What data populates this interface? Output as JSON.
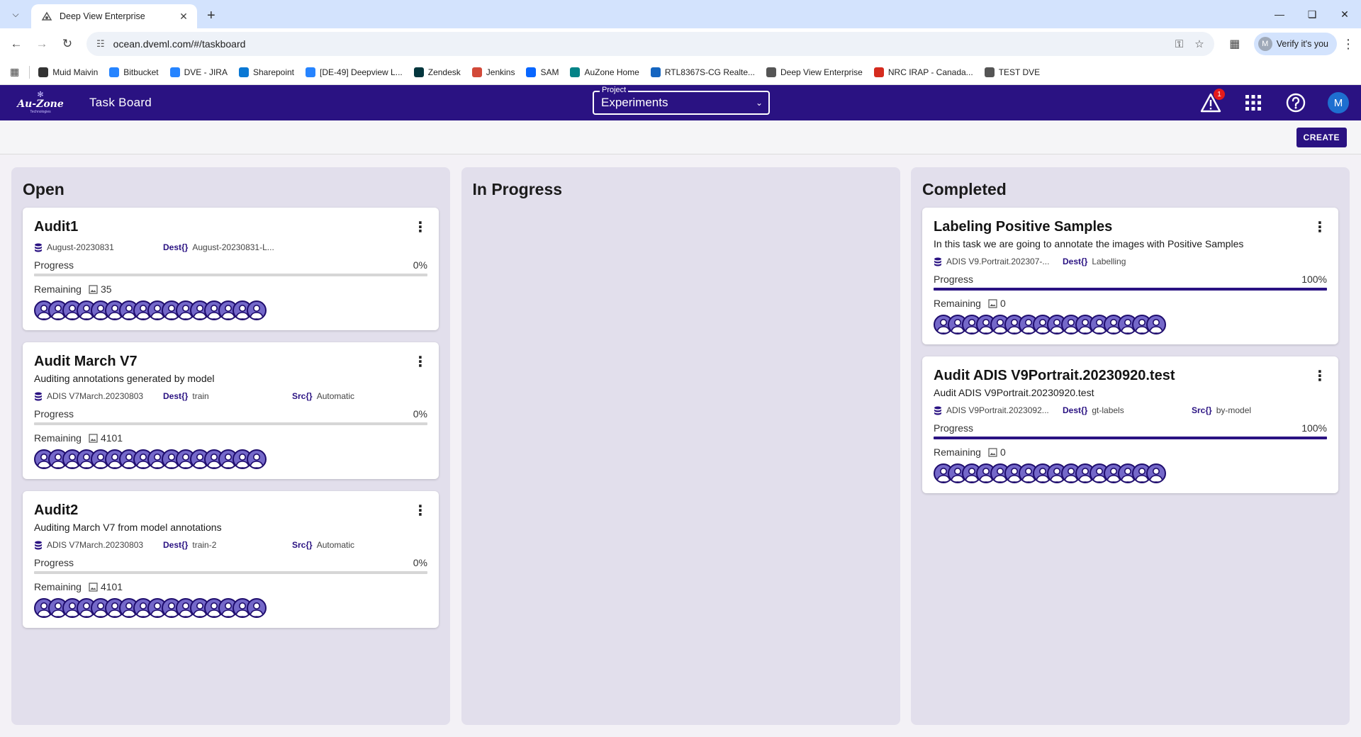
{
  "browser": {
    "tab_title": "Deep View Enterprise",
    "url": "ocean.dveml.com/#/taskboard",
    "verify_label": "Verify it's you",
    "profile_initial": "M",
    "bookmarks": [
      {
        "label": "Muid Maivin",
        "icon": "github-icon",
        "color": "#333333"
      },
      {
        "label": "Bitbucket",
        "icon": "bitbucket-icon",
        "color": "#2684ff"
      },
      {
        "label": "DVE - JIRA",
        "icon": "jira-icon",
        "color": "#2684ff"
      },
      {
        "label": "Sharepoint",
        "icon": "cloud-icon",
        "color": "#0a78d4"
      },
      {
        "label": "[DE-49] Deepview L...",
        "icon": "jira-icon",
        "color": "#2684ff"
      },
      {
        "label": "Zendesk",
        "icon": "zendesk-icon",
        "color": "#03363d"
      },
      {
        "label": "Jenkins",
        "icon": "jenkins-icon",
        "color": "#d24939"
      },
      {
        "label": "SAM",
        "icon": "meta-icon",
        "color": "#0866ff"
      },
      {
        "label": "AuZone Home",
        "icon": "sharepoint-icon",
        "color": "#038387"
      },
      {
        "label": "RTL8367S-CG Realte...",
        "icon": "lcsc-icon",
        "color": "#1565c0"
      },
      {
        "label": "Deep View Enterprise",
        "icon": "dve-icon",
        "color": "#555555"
      },
      {
        "label": "NRC IRAP - Canada...",
        "icon": "maple-leaf-icon",
        "color": "#d52b1e"
      },
      {
        "label": "TEST DVE",
        "icon": "dve-icon",
        "color": "#555555"
      }
    ]
  },
  "app": {
    "logo_text": "Au-Zone",
    "logo_sub": "Technologies",
    "title": "Task Board",
    "project_label": "Project",
    "project_value": "Experiments",
    "alert_count": "1",
    "user_initial": "M",
    "create_label": "CREATE"
  },
  "labels": {
    "progress": "Progress",
    "remaining": "Remaining",
    "dest": "Dest",
    "src": "Src",
    "braces": "{}"
  },
  "columns": [
    {
      "title": "Open",
      "cards": [
        {
          "title": "Audit1",
          "desc": "",
          "dataset": "August-20230831",
          "dest": "August-20230831-L...",
          "src": "",
          "progress_pct": 0,
          "progress_text": "0%",
          "remaining": "35"
        },
        {
          "title": "Audit March V7",
          "desc": "Auditing annotations generated by model",
          "dataset": "ADIS V7March.20230803",
          "dest": "train",
          "src": "Automatic",
          "progress_pct": 0,
          "progress_text": "0%",
          "remaining": "4101"
        },
        {
          "title": "Audit2",
          "desc": "Auditing March V7 from model annotations",
          "dataset": "ADIS V7March.20230803",
          "dest": "train-2",
          "src": "Automatic",
          "progress_pct": 0,
          "progress_text": "0%",
          "remaining": "4101"
        }
      ]
    },
    {
      "title": "In Progress",
      "cards": []
    },
    {
      "title": "Completed",
      "cards": [
        {
          "title": "Labeling Positive Samples",
          "desc": "In this task we are going to annotate the images with Positive Samples",
          "dataset": "ADIS V9.Portrait.202307-...",
          "dest": "Labelling",
          "src": "",
          "progress_pct": 100,
          "progress_text": "100%",
          "remaining": "0"
        },
        {
          "title": "Audit ADIS V9Portrait.20230920.test",
          "desc": "Audit ADIS V9Portrait.20230920.test",
          "dataset": "ADIS V9Portrait.2023092...",
          "dest": "gt-labels",
          "src": "by-model",
          "progress_pct": 100,
          "progress_text": "100%",
          "remaining": "0"
        }
      ]
    }
  ],
  "avatar_count": 16,
  "colors": {
    "brand": "#2a1282",
    "column_bg": "#e2dfec",
    "badge": "#e41b1b"
  }
}
